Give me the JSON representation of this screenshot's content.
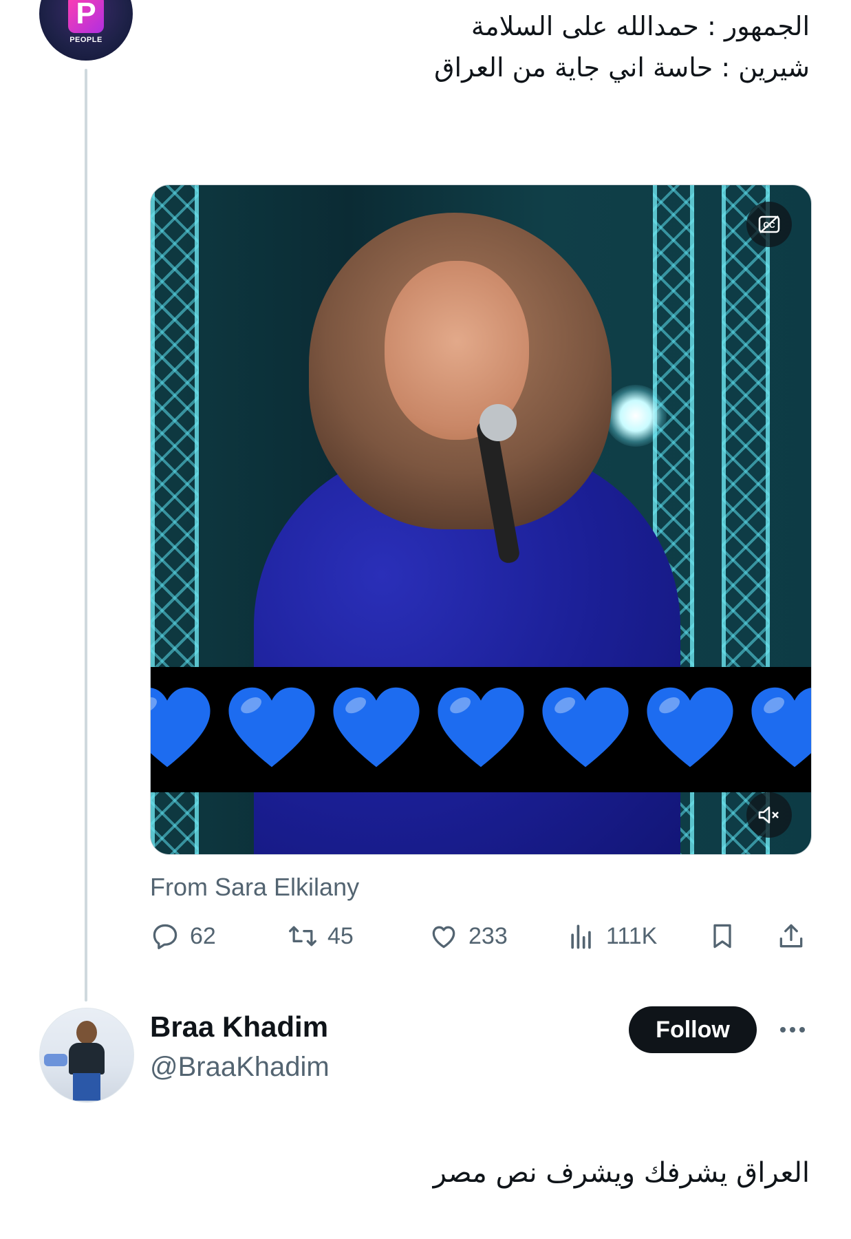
{
  "tweet1": {
    "avatar_brand": "PEOPLE",
    "lines": [
      "الجمهور : حمدالله على السلامة",
      "شيرين : حاسة اني جاية من العراق"
    ],
    "media": {
      "attribution": "From Sara Elkilany",
      "heart_count": 7,
      "heart_color": "#1d6cf0"
    },
    "actions": {
      "replies": "62",
      "retweets": "45",
      "likes": "233",
      "views": "111K"
    }
  },
  "tweet2": {
    "name": "Braa Khadim",
    "handle": "@BraaKhadim",
    "follow_label": "Follow",
    "text": "العراق يشرفك ويشرف نص مصر"
  },
  "colors": {
    "text_primary": "#0f1419",
    "text_secondary": "#536471",
    "thread_line": "#cfd9de",
    "follow_bg": "#0f1419"
  }
}
